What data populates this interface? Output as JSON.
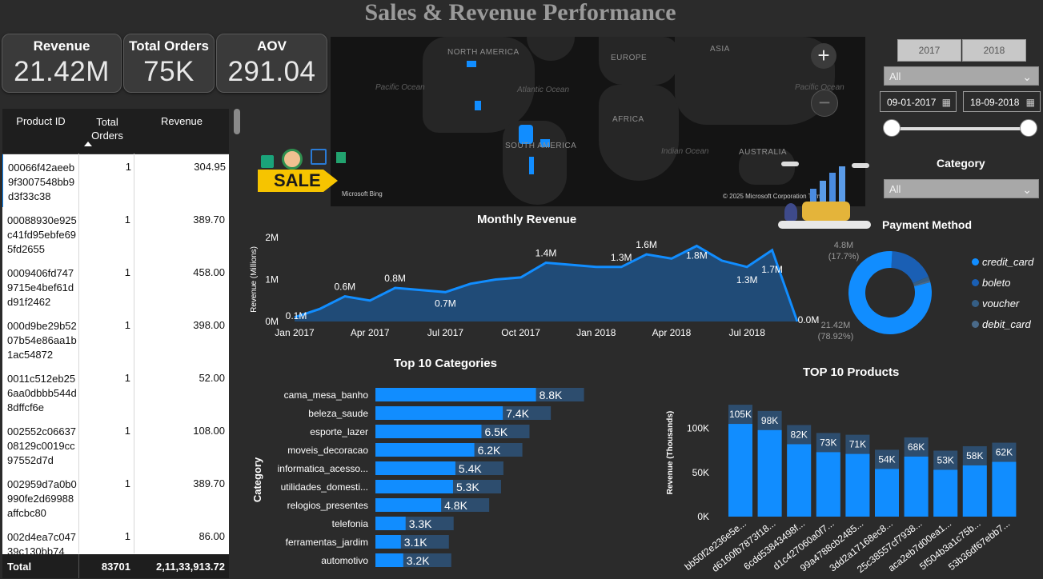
{
  "title": "Sales & Revenue Performance",
  "kpis": [
    {
      "label": "Revenue",
      "value": "21.42M"
    },
    {
      "label": "Total Orders",
      "value": "75K"
    },
    {
      "label": "AOV",
      "value": "291.04"
    }
  ],
  "table": {
    "headers": [
      "Product ID",
      "Total Orders",
      "Revenue"
    ],
    "rows": [
      {
        "pid": "00066f42aeeb9f3007548bb9d3f33c38",
        "orders": "1",
        "revenue": "304.95"
      },
      {
        "pid": "00088930e925c41fd95ebfe695fd2655",
        "orders": "1",
        "revenue": "389.70"
      },
      {
        "pid": "0009406fd7479715e4bef61dd91f2462",
        "orders": "1",
        "revenue": "458.00"
      },
      {
        "pid": "000d9be29b5207b54e86aa1b1ac54872",
        "orders": "1",
        "revenue": "398.00"
      },
      {
        "pid": "0011c512eb256aa0dbbb544d8dffcf6e",
        "orders": "1",
        "revenue": "52.00"
      },
      {
        "pid": "002552c0663708129c0019cc97552d7d",
        "orders": "1",
        "revenue": "108.00"
      },
      {
        "pid": "002959d7a0b0990fe2d69988affcbc80",
        "orders": "1",
        "revenue": "389.70"
      },
      {
        "pid": "002d4ea7c04739c130bb74",
        "orders": "1",
        "revenue": "86.00"
      }
    ],
    "total": {
      "label": "Total",
      "orders": "83701",
      "revenue": "2,11,33,913.72"
    }
  },
  "map": {
    "labels": [
      "NORTH AMERICA",
      "EUROPE",
      "ASIA",
      "AFRICA",
      "SOUTH AMERICA",
      "AUSTRALIA"
    ],
    "oceans": [
      "Pacific Ocean",
      "Atlantic Ocean",
      "Indian Ocean",
      "Pacific Ocean"
    ],
    "attribution": "© 2025 Microsoft Corporation Terms",
    "bing": "Microsoft Bing",
    "zoom_in": "+",
    "zoom_out": "−"
  },
  "sale_badge": "SALE",
  "slicers": {
    "years": [
      "2017",
      "2018"
    ],
    "state_dropdown": "All",
    "date_from": "09-01-2017",
    "date_to": "18-09-2018",
    "category_title": "Category",
    "category_dropdown": "All",
    "calendar_icon": "calendar-icon",
    "chevron_icon": "chevron-down-icon"
  },
  "chart_data": [
    {
      "type": "area",
      "title": "Monthly Revenue",
      "ylabel": "Revenue (Millions)",
      "xlabel": "",
      "x": [
        "Jan 2017",
        "Feb 2017",
        "Mar 2017",
        "Apr 2017",
        "May 2017",
        "Jun 2017",
        "Jul 2017",
        "Aug 2017",
        "Sep 2017",
        "Oct 2017",
        "Nov 2017",
        "Dec 2017",
        "Jan 2018",
        "Feb 2018",
        "Mar 2018",
        "Apr 2018",
        "May 2018",
        "Jun 2018",
        "Jul 2018",
        "Aug 2018",
        "Sep 2018"
      ],
      "values": [
        0.1,
        0.3,
        0.6,
        0.5,
        0.8,
        0.75,
        0.7,
        0.9,
        1.0,
        1.05,
        1.4,
        1.35,
        1.3,
        1.3,
        1.6,
        1.5,
        1.8,
        1.45,
        1.3,
        1.7,
        0.0
      ],
      "data_labels": [
        "0.1M",
        "",
        "0.6M",
        "",
        "0.8M",
        "",
        "0.7M",
        "",
        "",
        "",
        "1.4M",
        "",
        "",
        "1.3M",
        "1.6M",
        "",
        "1.8M",
        "",
        "1.3M",
        "1.7M",
        "0.0M"
      ],
      "xticks": [
        "Jan 2017",
        "Apr 2017",
        "Jul 2017",
        "Oct 2017",
        "Jan 2018",
        "Apr 2018",
        "Jul 2018"
      ],
      "yticks": [
        "0M",
        "1M",
        "2M"
      ],
      "ylim": [
        0,
        2
      ],
      "color": "#118dff"
    },
    {
      "type": "pie",
      "title": "Payment Method",
      "labels": [
        "credit_card",
        "boleto",
        "voucher",
        "debit_card"
      ],
      "values": [
        21.42,
        4.8,
        0.4,
        0.2
      ],
      "data_labels": [
        {
          "value": "21.42M",
          "pct": "(78.92%)"
        },
        {
          "value": "4.8M",
          "pct": "(17.7%)"
        }
      ],
      "colors": [
        "#118dff",
        "#1a5fb4",
        "#355e85",
        "#4a6a89"
      ]
    },
    {
      "type": "bar",
      "title": "Top 10 Categories",
      "ylabel": "Category",
      "categories": [
        "cama_mesa_banho",
        "beleza_saude",
        "esporte_lazer",
        "moveis_decoracao",
        "informatica_acesso...",
        "utilidades_domesti...",
        "relogios_presentes",
        "telefonia",
        "ferramentas_jardim",
        "automotivo"
      ],
      "values": [
        8.8,
        7.4,
        6.5,
        6.2,
        5.4,
        5.3,
        4.8,
        3.3,
        3.1,
        3.2
      ],
      "data_labels": [
        "8.8K",
        "7.4K",
        "6.5K",
        "6.2K",
        "5.4K",
        "5.3K",
        "4.8K",
        "3.3K",
        "3.1K",
        "3.2K"
      ],
      "xlim": [
        0,
        10.3
      ],
      "color": "#118dff"
    },
    {
      "type": "bar",
      "title": "TOP 10 Products",
      "ylabel": "Revenue (Thousands)",
      "categories": [
        "bb50f2e236e5e...",
        "d6160fb7873f18...",
        "6cdd53843498f...",
        "d1c427060a0f7...",
        "99a4788cb2485...",
        "3dd2a17168ec8...",
        "25c38557cf7938...",
        "aca2eb7d00ea1...",
        "5f504b3a1c75b...",
        "53b36df67ebb7..."
      ],
      "values": [
        105,
        98,
        82,
        73,
        71,
        54,
        68,
        53,
        58,
        62
      ],
      "data_labels": [
        "105K",
        "98K",
        "82K",
        "73K",
        "71K",
        "54K",
        "68K",
        "53K",
        "58K",
        "62K"
      ],
      "yticks": [
        "0K",
        "50K",
        "100K"
      ],
      "ylim": [
        0,
        125
      ],
      "color": "#118dff"
    }
  ]
}
